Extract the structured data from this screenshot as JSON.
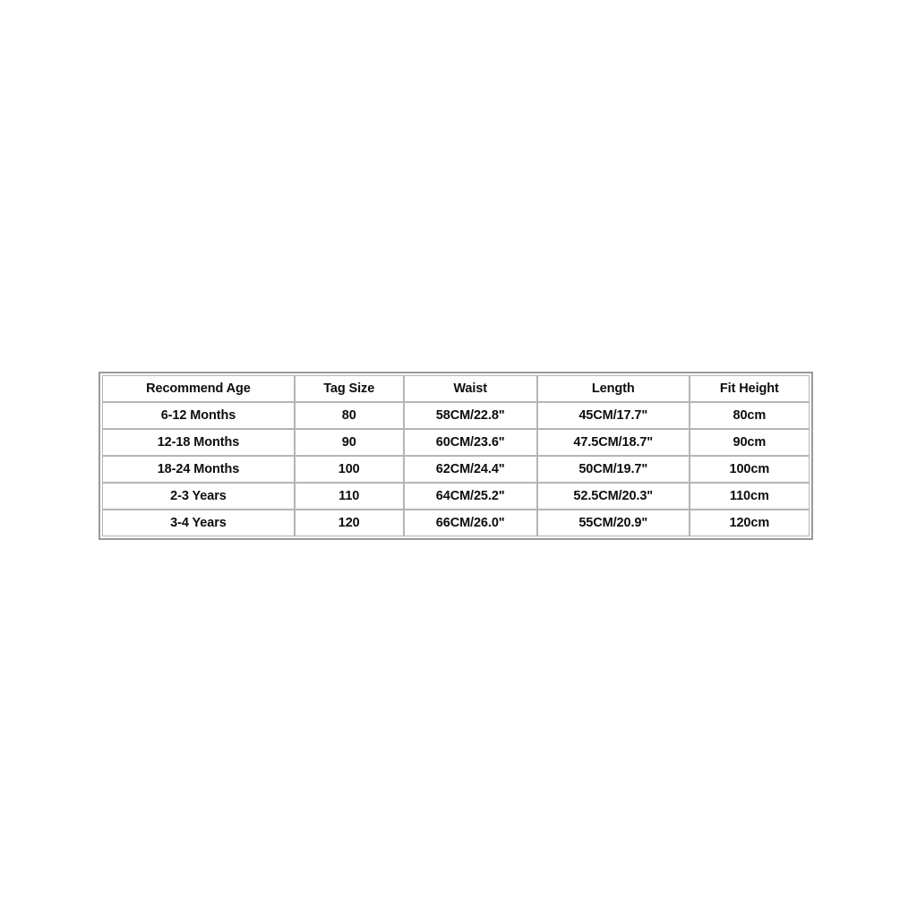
{
  "page": {
    "background_color": "#ffffff",
    "text_color": "#0d0d0d",
    "border_color": "#b5b5b5",
    "outer_border_color": "#9a9a9a"
  },
  "size_chart": {
    "columns": [
      "Recommend Age",
      "Tag Size",
      "Waist",
      "Length",
      "Fit Height"
    ],
    "rows": [
      {
        "recommend_age": "6-12 Months",
        "tag_size": "80",
        "waist": "58CM/22.8\"",
        "length": "45CM/17.7\"",
        "fit_height": "80cm"
      },
      {
        "recommend_age": "12-18 Months",
        "tag_size": "90",
        "waist": "60CM/23.6\"",
        "length": "47.5CM/18.7\"",
        "fit_height": "90cm"
      },
      {
        "recommend_age": "18-24 Months",
        "tag_size": "100",
        "waist": "62CM/24.4\"",
        "length": "50CM/19.7\"",
        "fit_height": "100cm"
      },
      {
        "recommend_age": "2-3 Years",
        "tag_size": "110",
        "waist": "64CM/25.2\"",
        "length": "52.5CM/20.3\"",
        "fit_height": "110cm"
      },
      {
        "recommend_age": "3-4 Years",
        "tag_size": "120",
        "waist": "66CM/26.0\"",
        "length": "55CM/20.9\"",
        "fit_height": "120cm"
      }
    ]
  }
}
